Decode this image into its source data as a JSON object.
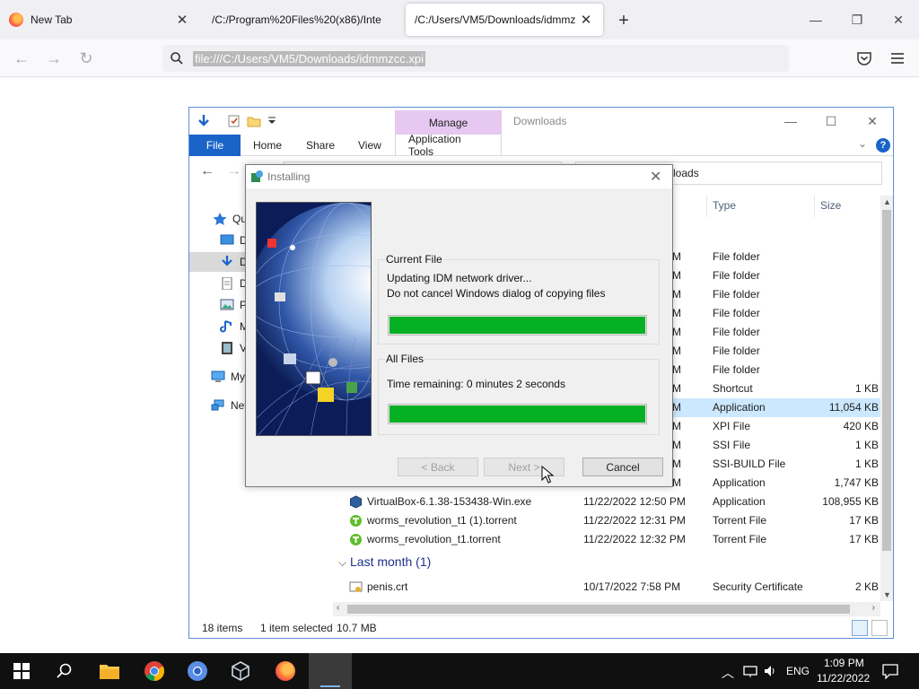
{
  "browser": {
    "tabs": [
      {
        "title": "New Tab",
        "active": false
      },
      {
        "title": "/C:/Program%20Files%20(x86)/Inte",
        "active": false
      },
      {
        "title": "/C:/Users/VM5/Downloads/idmmz",
        "active": true
      }
    ],
    "url": "file:///C:/Users/VM5/Downloads/idmmzcc.xpi",
    "icons": [
      "firefox-icon",
      "back-icon",
      "forward-icon",
      "reload-icon",
      "search-icon",
      "pocket-icon",
      "menu-icon",
      "new-tab-icon",
      "minimize-icon",
      "restore-icon",
      "close-icon"
    ]
  },
  "explorer": {
    "manage_tab": "Manage",
    "window_title": "Downloads",
    "ribbon": {
      "file": "File",
      "home": "Home",
      "share": "Share",
      "view": "View",
      "application_tools": "Application Tools"
    },
    "address_fragment": "loads",
    "columns": {
      "type": "Type",
      "size": "Size"
    },
    "sidebar": [
      {
        "label": "Qui",
        "icon": "star-icon"
      },
      {
        "label": "D",
        "icon": "desktop-icon"
      },
      {
        "label": "D",
        "icon": "downloads-icon",
        "selected": true
      },
      {
        "label": "D",
        "icon": "documents-icon"
      },
      {
        "label": "Pi",
        "icon": "pictures-icon"
      },
      {
        "label": "M",
        "icon": "music-icon"
      },
      {
        "label": "Vi",
        "icon": "videos-icon"
      },
      {
        "label": "My",
        "icon": "this-pc-icon"
      },
      {
        "label": "Net",
        "icon": "network-icon"
      }
    ],
    "rows": [
      {
        "mark": "M",
        "type": "File folder",
        "size": ""
      },
      {
        "mark": "M",
        "type": "File folder",
        "size": ""
      },
      {
        "mark": "M",
        "type": "File folder",
        "size": ""
      },
      {
        "mark": "M",
        "type": "File folder",
        "size": ""
      },
      {
        "mark": "M",
        "type": "File folder",
        "size": ""
      },
      {
        "mark": "M",
        "type": "File folder",
        "size": ""
      },
      {
        "mark": "M",
        "type": "File folder",
        "size": ""
      },
      {
        "mark": "M",
        "type": "Shortcut",
        "size": "1 KB"
      },
      {
        "mark": "M",
        "type": "Application",
        "size": "11,054 KB",
        "selected": true
      },
      {
        "mark": "M",
        "type": "XPI File",
        "size": "420 KB"
      },
      {
        "mark": "M",
        "type": "SSI File",
        "size": "1 KB"
      },
      {
        "mark": "M",
        "type": "SSI-BUILD File",
        "size": "1 KB"
      },
      {
        "mark": "M",
        "type": "Application",
        "size": "1,747 KB"
      }
    ],
    "files": [
      {
        "name": "VirtualBox-6.1.38-153438-Win.exe",
        "date": "11/22/2022 12:50 PM",
        "type": "Application",
        "size": "108,955 KB",
        "icon": "virtualbox-icon"
      },
      {
        "name": "worms_revolution_t1 (1).torrent",
        "date": "11/22/2022 12:31 PM",
        "type": "Torrent File",
        "size": "17 KB",
        "icon": "torrent-icon"
      },
      {
        "name": "worms_revolution_t1.torrent",
        "date": "11/22/2022 12:32 PM",
        "type": "Torrent File",
        "size": "17 KB",
        "icon": "torrent-icon"
      }
    ],
    "group_last_month": "Last month (1)",
    "last_month_files": [
      {
        "name": "penis.crt",
        "date": "10/17/2022 7:58 PM",
        "type": "Security Certificate",
        "size": "2 KB",
        "icon": "certificate-icon"
      }
    ],
    "status": {
      "items": "18 items",
      "selected": "1 item selected",
      "size": "10.7 MB"
    }
  },
  "dialog": {
    "title": "Installing",
    "current_file_label": "Current File",
    "current_file_line1": "Updating IDM network driver...",
    "current_file_line2": "Do not cancel Windows dialog of copying files",
    "current_file_progress": 100,
    "all_files_label": "All Files",
    "time_remaining": "Time remaining: 0 minutes 2 seconds",
    "all_files_progress": 100,
    "back_button": "< Back",
    "next_button": "Next >",
    "cancel_button": "Cancel",
    "progress_color": "#06b025"
  },
  "taskbar": {
    "time": "1:09 PM",
    "date": "11/22/2022",
    "language": "ENG",
    "apps": [
      "start-icon",
      "search-icon",
      "file-explorer-icon",
      "chrome-icon",
      "chromium-icon",
      "virtualbox-icon",
      "firefox-icon",
      "installer-icon"
    ]
  }
}
